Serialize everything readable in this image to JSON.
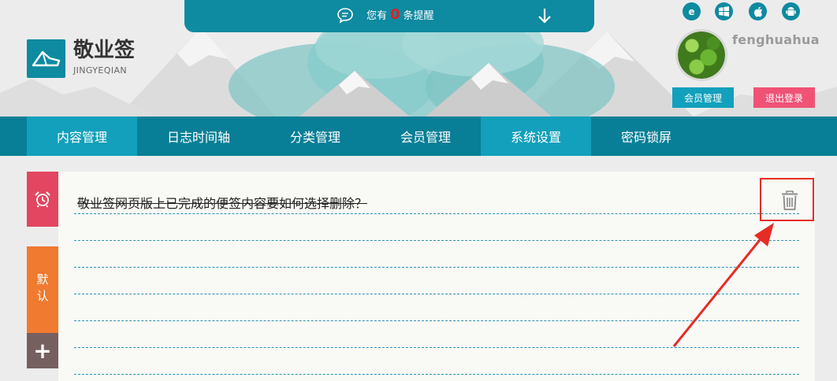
{
  "notice": {
    "prefix": "您有",
    "count": "0",
    "suffix": "条提醒",
    "icons": [
      "chat-bubble-icon",
      "arrow-down-icon"
    ]
  },
  "brand": {
    "title": "敬业签",
    "subtitle": "JINGYEQIAN",
    "logo_icon": "note-logo-icon"
  },
  "platforms": [
    {
      "name": "ie-icon",
      "glyph": "e"
    },
    {
      "name": "windows-icon",
      "glyph": "⊞"
    },
    {
      "name": "apple-icon",
      "glyph": ""
    },
    {
      "name": "android-icon",
      "glyph": "◉"
    }
  ],
  "user": {
    "name": "fenghuahua",
    "member_btn": "会员管理",
    "logout_btn": "退出登录"
  },
  "nav": {
    "items": [
      {
        "label": "内容管理",
        "active": true
      },
      {
        "label": "日志时间轴",
        "active": false
      },
      {
        "label": "分类管理",
        "active": false
      },
      {
        "label": "会员管理",
        "active": false
      },
      {
        "label": "系统设置",
        "active": true
      },
      {
        "label": "密码锁屏",
        "active": false
      }
    ]
  },
  "sidebar": {
    "alarm_icon": "alarm-clock-icon",
    "default_label": "默认",
    "add_label": "+"
  },
  "note": {
    "text": "敬业签网页版上已完成的便签内容要如何选择删除？",
    "delete_icon": "trash-icon",
    "completed": true
  },
  "colors": {
    "primary": "#087f96",
    "accent": "#12a0bc",
    "logout": "#f05276",
    "alarm": "#e24660",
    "category": "#f07a2f",
    "add": "#76605f",
    "annotation": "#e52c25"
  }
}
